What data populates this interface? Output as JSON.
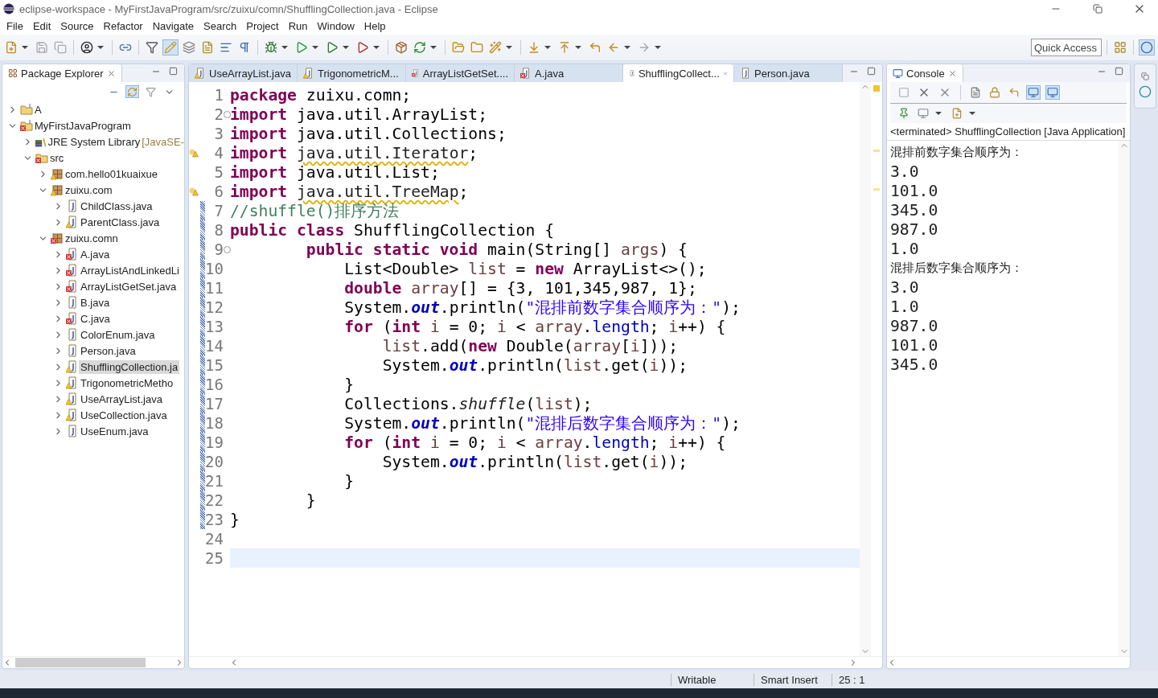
{
  "window": {
    "title": "eclipse-workspace - MyFirstJavaProgram/src/zuixu/comn/ShufflingCollection.java - Eclipse"
  },
  "menu": [
    "File",
    "Edit",
    "Source",
    "Refactor",
    "Navigate",
    "Search",
    "Project",
    "Run",
    "Window",
    "Help"
  ],
  "quick_access": {
    "placeholder": "Quick Access"
  },
  "package_explorer": {
    "title": "Package Explorer",
    "selected": true,
    "tree": [
      {
        "label": "A",
        "kind": "project",
        "error": false,
        "warning": false,
        "expanded": false,
        "selected": false
      },
      {
        "label": "MyFirstJavaProgram",
        "kind": "project",
        "error": true,
        "warning": false,
        "expanded": true,
        "selected": false,
        "children": [
          {
            "label": "JRE System Library",
            "suffix": "[JavaSE-",
            "kind": "library",
            "error": false,
            "warning": false,
            "expanded": false,
            "selected": false
          },
          {
            "label": "src",
            "kind": "folder",
            "error": true,
            "warning": false,
            "expanded": true,
            "selected": false,
            "children": [
              {
                "label": "com.hello01kuaixue",
                "kind": "package",
                "error": false,
                "warning": true,
                "expanded": false,
                "selected": false
              },
              {
                "label": "zuixu.com",
                "kind": "package",
                "error": false,
                "warning": true,
                "expanded": true,
                "selected": false,
                "children": [
                  {
                    "label": "ChildClass.java",
                    "kind": "java",
                    "error": false,
                    "warning": false,
                    "expanded": false,
                    "selected": false
                  },
                  {
                    "label": "ParentClass.java",
                    "kind": "java",
                    "error": false,
                    "warning": true,
                    "expanded": false,
                    "selected": false
                  }
                ]
              },
              {
                "label": "zuixu.comn",
                "kind": "package",
                "error": true,
                "warning": false,
                "expanded": true,
                "selected": false,
                "children": [
                  {
                    "label": "A.java",
                    "kind": "java",
                    "error": true,
                    "warning": false,
                    "expanded": false,
                    "selected": false
                  },
                  {
                    "label": "ArrayListAndLinkedLi",
                    "kind": "java",
                    "error": true,
                    "warning": false,
                    "expanded": false,
                    "selected": false
                  },
                  {
                    "label": "ArrayListGetSet.java",
                    "kind": "java",
                    "error": true,
                    "warning": false,
                    "expanded": false,
                    "selected": false
                  },
                  {
                    "label": "B.java",
                    "kind": "java",
                    "error": false,
                    "warning": false,
                    "expanded": false,
                    "selected": false
                  },
                  {
                    "label": "C.java",
                    "kind": "java",
                    "error": true,
                    "warning": false,
                    "expanded": false,
                    "selected": false
                  },
                  {
                    "label": "ColorEnum.java",
                    "kind": "java",
                    "error": false,
                    "warning": false,
                    "expanded": false,
                    "selected": false
                  },
                  {
                    "label": "Person.java",
                    "kind": "java",
                    "error": false,
                    "warning": false,
                    "expanded": false,
                    "selected": false
                  },
                  {
                    "label": "ShufflingCollection.ja",
                    "kind": "java",
                    "error": false,
                    "warning": true,
                    "expanded": false,
                    "selected": true
                  },
                  {
                    "label": "TrigonometricMetho",
                    "kind": "java",
                    "error": false,
                    "warning": true,
                    "expanded": false,
                    "selected": false
                  },
                  {
                    "label": "UseArrayList.java",
                    "kind": "java",
                    "error": false,
                    "warning": true,
                    "expanded": false,
                    "selected": false
                  },
                  {
                    "label": "UseCollection.java",
                    "kind": "java",
                    "error": false,
                    "warning": true,
                    "expanded": false,
                    "selected": false
                  },
                  {
                    "label": "UseEnum.java",
                    "kind": "java",
                    "error": false,
                    "warning": false,
                    "expanded": false,
                    "selected": false
                  }
                ]
              }
            ]
          }
        ]
      }
    ]
  },
  "editor": {
    "tabs": [
      {
        "label": "UseArrayList.java",
        "error": false,
        "warning": true,
        "selected": false
      },
      {
        "label": "TrigonometricM...",
        "error": false,
        "warning": true,
        "selected": false
      },
      {
        "label": "ArrayListGetSet....",
        "error": true,
        "warning": false,
        "selected": false
      },
      {
        "label": "A.java",
        "error": true,
        "warning": false,
        "selected": false
      },
      {
        "label": "ShufflingCollect...",
        "error": false,
        "warning": false,
        "selected": true
      },
      {
        "label": "Person.java",
        "error": false,
        "warning": false,
        "selected": false
      }
    ],
    "lines": [
      {
        "n": "1",
        "warning": false,
        "fold": false,
        "changed": false,
        "current": false,
        "tokens": [
          {
            "kind": "kw",
            "t": "package"
          },
          {
            "kind": "p",
            "t": " zuixu.comn;"
          }
        ]
      },
      {
        "n": "2",
        "warning": false,
        "fold": true,
        "changed": false,
        "current": false,
        "tokens": [
          {
            "kind": "kw",
            "t": "import"
          },
          {
            "kind": "p",
            "t": " java.util.ArrayList;"
          }
        ]
      },
      {
        "n": "3",
        "warning": false,
        "fold": false,
        "changed": false,
        "current": false,
        "tokens": [
          {
            "kind": "kw",
            "t": "import"
          },
          {
            "kind": "p",
            "t": " java.util.Collections;"
          }
        ]
      },
      {
        "n": "4",
        "warning": true,
        "fold": false,
        "changed": false,
        "current": false,
        "tokens": [
          {
            "kind": "kw",
            "t": "import "
          },
          {
            "kind": "unused",
            "t": "java.util.Iterator"
          },
          {
            "kind": "p",
            "t": ";"
          }
        ]
      },
      {
        "n": "5",
        "warning": false,
        "fold": false,
        "changed": false,
        "current": false,
        "tokens": [
          {
            "kind": "kw",
            "t": "import"
          },
          {
            "kind": "p",
            "t": " java.util.List;"
          }
        ]
      },
      {
        "n": "6",
        "warning": true,
        "fold": false,
        "changed": false,
        "current": false,
        "tokens": [
          {
            "kind": "kw",
            "t": "import "
          },
          {
            "kind": "unused",
            "t": "java.util.TreeMap"
          },
          {
            "kind": "p",
            "t": ";"
          }
        ]
      },
      {
        "n": "7",
        "warning": false,
        "fold": false,
        "changed": true,
        "current": false,
        "tokens": [
          {
            "kind": "cm",
            "t": "//shuffle()排序方法"
          }
        ]
      },
      {
        "n": "8",
        "warning": false,
        "fold": false,
        "changed": true,
        "current": false,
        "tokens": [
          {
            "kind": "kw",
            "t": "public class"
          },
          {
            "kind": "p",
            "t": " ShufflingCollection {"
          }
        ]
      },
      {
        "n": "9",
        "warning": false,
        "fold": true,
        "changed": true,
        "current": false,
        "tokens": [
          {
            "kind": "kw",
            "t": "        public static void"
          },
          {
            "kind": "p",
            "t": " main(String[] "
          },
          {
            "kind": "var",
            "t": "args"
          },
          {
            "kind": "p",
            "t": ") {"
          }
        ]
      },
      {
        "n": "10",
        "warning": false,
        "fold": false,
        "changed": true,
        "current": false,
        "tokens": [
          {
            "kind": "p",
            "t": "            List<Double> "
          },
          {
            "kind": "var",
            "t": "list"
          },
          {
            "kind": "p",
            "t": " = "
          },
          {
            "kind": "kw",
            "t": "new"
          },
          {
            "kind": "p",
            "t": " ArrayList<>();"
          }
        ]
      },
      {
        "n": "11",
        "warning": false,
        "fold": false,
        "changed": true,
        "current": false,
        "tokens": [
          {
            "kind": "kw",
            "t": "            double "
          },
          {
            "kind": "var",
            "t": "array"
          },
          {
            "kind": "p",
            "t": "[] = {3, 101,345,987, 1};"
          }
        ]
      },
      {
        "n": "12",
        "warning": false,
        "fold": false,
        "changed": true,
        "current": false,
        "tokens": [
          {
            "kind": "p",
            "t": "            System."
          },
          {
            "kind": "fld",
            "t": "out"
          },
          {
            "kind": "p",
            "t": ".println("
          },
          {
            "kind": "str",
            "t": "\"混排前数字集合顺序为：\""
          },
          {
            "kind": "p",
            "t": ");"
          }
        ]
      },
      {
        "n": "13",
        "warning": false,
        "fold": false,
        "changed": true,
        "current": false,
        "tokens": [
          {
            "kind": "kw",
            "t": "            for"
          },
          {
            "kind": "p",
            "t": " ("
          },
          {
            "kind": "kw",
            "t": "int "
          },
          {
            "kind": "var",
            "t": "i"
          },
          {
            "kind": "p",
            "t": " = 0; "
          },
          {
            "kind": "var",
            "t": "i"
          },
          {
            "kind": "p",
            "t": " < "
          },
          {
            "kind": "var",
            "t": "array"
          },
          {
            "kind": "p",
            "t": "."
          },
          {
            "kind": "mem",
            "t": "length"
          },
          {
            "kind": "p",
            "t": "; "
          },
          {
            "kind": "var",
            "t": "i"
          },
          {
            "kind": "p",
            "t": "++) {"
          }
        ]
      },
      {
        "n": "14",
        "warning": false,
        "fold": false,
        "changed": true,
        "current": false,
        "tokens": [
          {
            "kind": "var",
            "t": "                list"
          },
          {
            "kind": "p",
            "t": ".add("
          },
          {
            "kind": "kw",
            "t": "new"
          },
          {
            "kind": "p",
            "t": " Double("
          },
          {
            "kind": "var",
            "t": "array"
          },
          {
            "kind": "p",
            "t": "["
          },
          {
            "kind": "var",
            "t": "i"
          },
          {
            "kind": "p",
            "t": "]));"
          }
        ]
      },
      {
        "n": "15",
        "warning": false,
        "fold": false,
        "changed": true,
        "current": false,
        "tokens": [
          {
            "kind": "p",
            "t": "                System."
          },
          {
            "kind": "fld",
            "t": "out"
          },
          {
            "kind": "p",
            "t": ".println("
          },
          {
            "kind": "var",
            "t": "list"
          },
          {
            "kind": "p",
            "t": ".get("
          },
          {
            "kind": "var",
            "t": "i"
          },
          {
            "kind": "p",
            "t": "));"
          }
        ]
      },
      {
        "n": "16",
        "warning": false,
        "fold": false,
        "changed": true,
        "current": false,
        "tokens": [
          {
            "kind": "p",
            "t": "            }"
          }
        ]
      },
      {
        "n": "17",
        "warning": false,
        "fold": false,
        "changed": true,
        "current": false,
        "tokens": [
          {
            "kind": "p",
            "t": "            Collections."
          },
          {
            "kind": "smeth",
            "t": "shuffle"
          },
          {
            "kind": "p",
            "t": "("
          },
          {
            "kind": "var",
            "t": "list"
          },
          {
            "kind": "p",
            "t": ");"
          }
        ]
      },
      {
        "n": "18",
        "warning": false,
        "fold": false,
        "changed": true,
        "current": false,
        "tokens": [
          {
            "kind": "p",
            "t": "            System."
          },
          {
            "kind": "fld",
            "t": "out"
          },
          {
            "kind": "p",
            "t": ".println("
          },
          {
            "kind": "str",
            "t": "\"混排后数字集合顺序为：\""
          },
          {
            "kind": "p",
            "t": ");"
          }
        ]
      },
      {
        "n": "19",
        "warning": false,
        "fold": false,
        "changed": true,
        "current": false,
        "tokens": [
          {
            "kind": "kw",
            "t": "            for"
          },
          {
            "kind": "p",
            "t": " ("
          },
          {
            "kind": "kw",
            "t": "int "
          },
          {
            "kind": "var",
            "t": "i"
          },
          {
            "kind": "p",
            "t": " = 0; "
          },
          {
            "kind": "var",
            "t": "i"
          },
          {
            "kind": "p",
            "t": " < "
          },
          {
            "kind": "var",
            "t": "array"
          },
          {
            "kind": "p",
            "t": "."
          },
          {
            "kind": "mem",
            "t": "length"
          },
          {
            "kind": "p",
            "t": "; "
          },
          {
            "kind": "var",
            "t": "i"
          },
          {
            "kind": "p",
            "t": "++) {"
          }
        ]
      },
      {
        "n": "20",
        "warning": false,
        "fold": false,
        "changed": true,
        "current": false,
        "tokens": [
          {
            "kind": "p",
            "t": "                System."
          },
          {
            "kind": "fld",
            "t": "out"
          },
          {
            "kind": "p",
            "t": ".println("
          },
          {
            "kind": "var",
            "t": "list"
          },
          {
            "kind": "p",
            "t": ".get("
          },
          {
            "kind": "var",
            "t": "i"
          },
          {
            "kind": "p",
            "t": "));"
          }
        ]
      },
      {
        "n": "21",
        "warning": false,
        "fold": false,
        "changed": true,
        "current": false,
        "tokens": [
          {
            "kind": "p",
            "t": "            }"
          }
        ]
      },
      {
        "n": "22",
        "warning": false,
        "fold": false,
        "changed": true,
        "current": false,
        "tokens": [
          {
            "kind": "p",
            "t": "        }"
          }
        ]
      },
      {
        "n": "23",
        "warning": false,
        "fold": false,
        "changed": true,
        "current": false,
        "tokens": [
          {
            "kind": "p",
            "t": "}"
          }
        ]
      },
      {
        "n": "24",
        "warning": false,
        "fold": false,
        "changed": false,
        "current": false
      },
      {
        "n": "25",
        "warning": false,
        "fold": false,
        "changed": false,
        "current": true
      }
    ]
  },
  "console": {
    "title": "Console",
    "selected": true,
    "header": "<terminated> ShufflingCollection [Java Application]",
    "output": [
      "混排前数字集合顺序为：",
      "3.0",
      "101.0",
      "345.0",
      "987.0",
      "1.0",
      "混排后数字集合顺序为：",
      "3.0",
      "1.0",
      "987.0",
      "101.0",
      "345.0"
    ]
  },
  "status_bar": [
    "Writable",
    "Smart Insert",
    "25 : 1"
  ]
}
